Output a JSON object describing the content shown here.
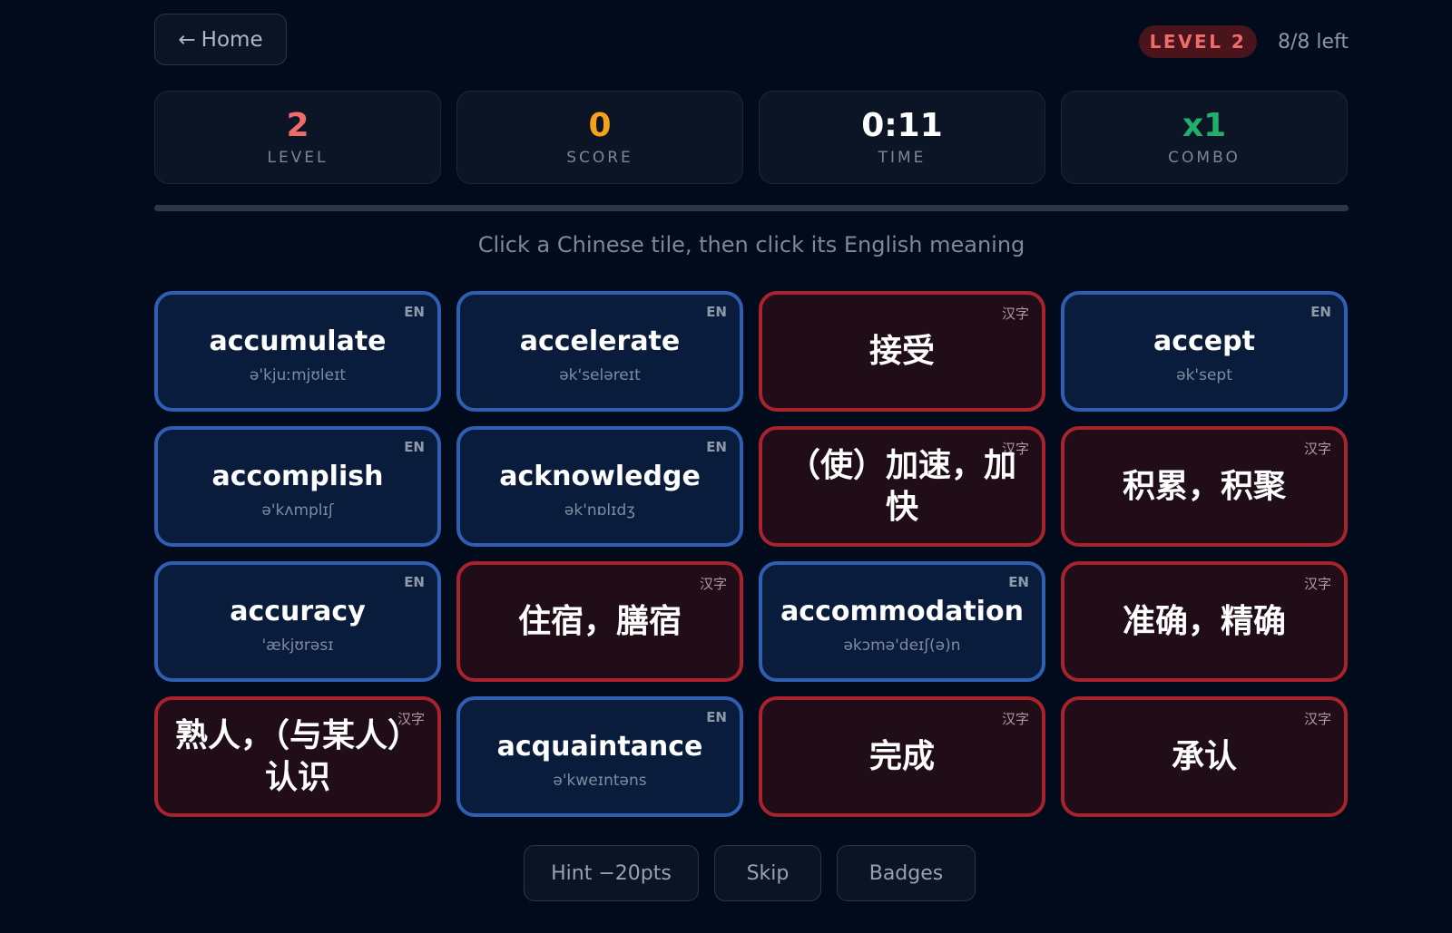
{
  "nav": {
    "home_label": "Home",
    "home_icon": "arrow-left-icon"
  },
  "header": {
    "level_badge": "LEVEL 2",
    "remaining": "8/8 left"
  },
  "stats": [
    {
      "value": "2",
      "label": "LEVEL",
      "color": "#f26b6b"
    },
    {
      "value": "0",
      "label": "SCORE",
      "color": "#f5a11c"
    },
    {
      "value": "0:11",
      "label": "TIME",
      "color": "#ffffff"
    },
    {
      "value": "x1",
      "label": "COMBO",
      "color": "#20b06a"
    }
  ],
  "progress": {
    "fraction": 0
  },
  "instruction": "Click a Chinese tile, then click its English meaning",
  "tiles": [
    {
      "type": "en",
      "tag": "EN",
      "word": "accumulate",
      "phonetic": "ə'kjuːmjʊleɪt"
    },
    {
      "type": "en",
      "tag": "EN",
      "word": "accelerate",
      "phonetic": "ək'seləreɪt"
    },
    {
      "type": "zh",
      "tag": "汉字",
      "text": "接受"
    },
    {
      "type": "en",
      "tag": "EN",
      "word": "accept",
      "phonetic": "ək'sept"
    },
    {
      "type": "en",
      "tag": "EN",
      "word": "accomplish",
      "phonetic": "ə'kʌmplɪʃ"
    },
    {
      "type": "en",
      "tag": "EN",
      "word": "acknowledge",
      "phonetic": "ək'nɒlɪdʒ"
    },
    {
      "type": "zh",
      "tag": "汉字",
      "text": "（使）加速，加快"
    },
    {
      "type": "zh",
      "tag": "汉字",
      "text": "积累，积聚"
    },
    {
      "type": "en",
      "tag": "EN",
      "word": "accuracy",
      "phonetic": "'ækjʊrəsɪ"
    },
    {
      "type": "zh",
      "tag": "汉字",
      "text": "住宿，膳宿"
    },
    {
      "type": "en",
      "tag": "EN",
      "word": "accommodation",
      "phonetic": "əkɔmə'deɪʃ(ə)n"
    },
    {
      "type": "zh",
      "tag": "汉字",
      "text": "准确，精确"
    },
    {
      "type": "zh",
      "tag": "汉字",
      "text": "熟人，（与某人）认识"
    },
    {
      "type": "en",
      "tag": "EN",
      "word": "acquaintance",
      "phonetic": "ə'kweɪntəns"
    },
    {
      "type": "zh",
      "tag": "汉字",
      "text": "完成"
    },
    {
      "type": "zh",
      "tag": "汉字",
      "text": "承认"
    }
  ],
  "actions": [
    {
      "label": "Hint −20pts"
    },
    {
      "label": "Skip"
    },
    {
      "label": "Badges"
    }
  ]
}
